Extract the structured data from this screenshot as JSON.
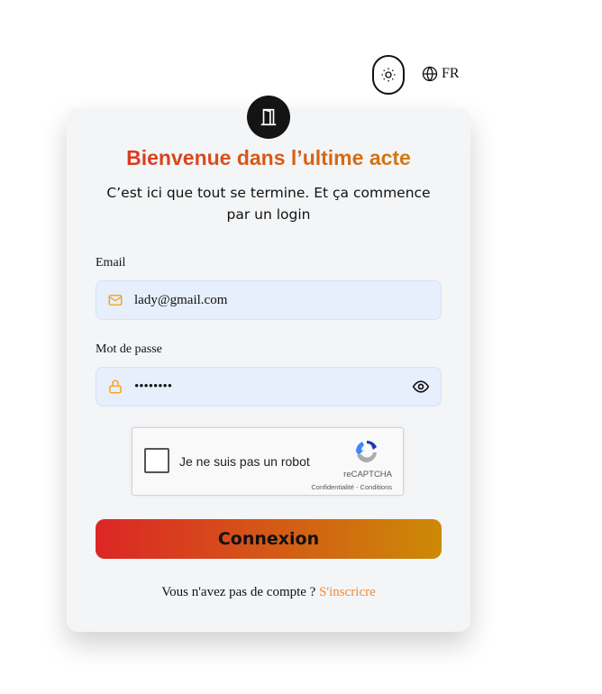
{
  "header": {
    "theme_icon": "sun-icon",
    "language": "FR"
  },
  "card": {
    "title": "Bienvenue dans l’ultime acte",
    "subtitle": "C’est ici que tout se termine. Et ça commence par un login",
    "email_label": "Email",
    "email_value": "lady@gmail.com",
    "password_label": "Mot de passe",
    "password_value": "••••••••",
    "captcha": {
      "label": "Je ne suis pas un robot",
      "brand": "reCAPTCHA",
      "links": "Confidentialité - Conditions"
    },
    "login_button": "Connexion",
    "signup_prompt": "Vous n'avez pas de compte ?",
    "signup_link": "S'inscricre"
  },
  "colors": {
    "accent": "#f59e0b",
    "gradient_start": "#dc2626",
    "gradient_end": "#cc8a06"
  }
}
